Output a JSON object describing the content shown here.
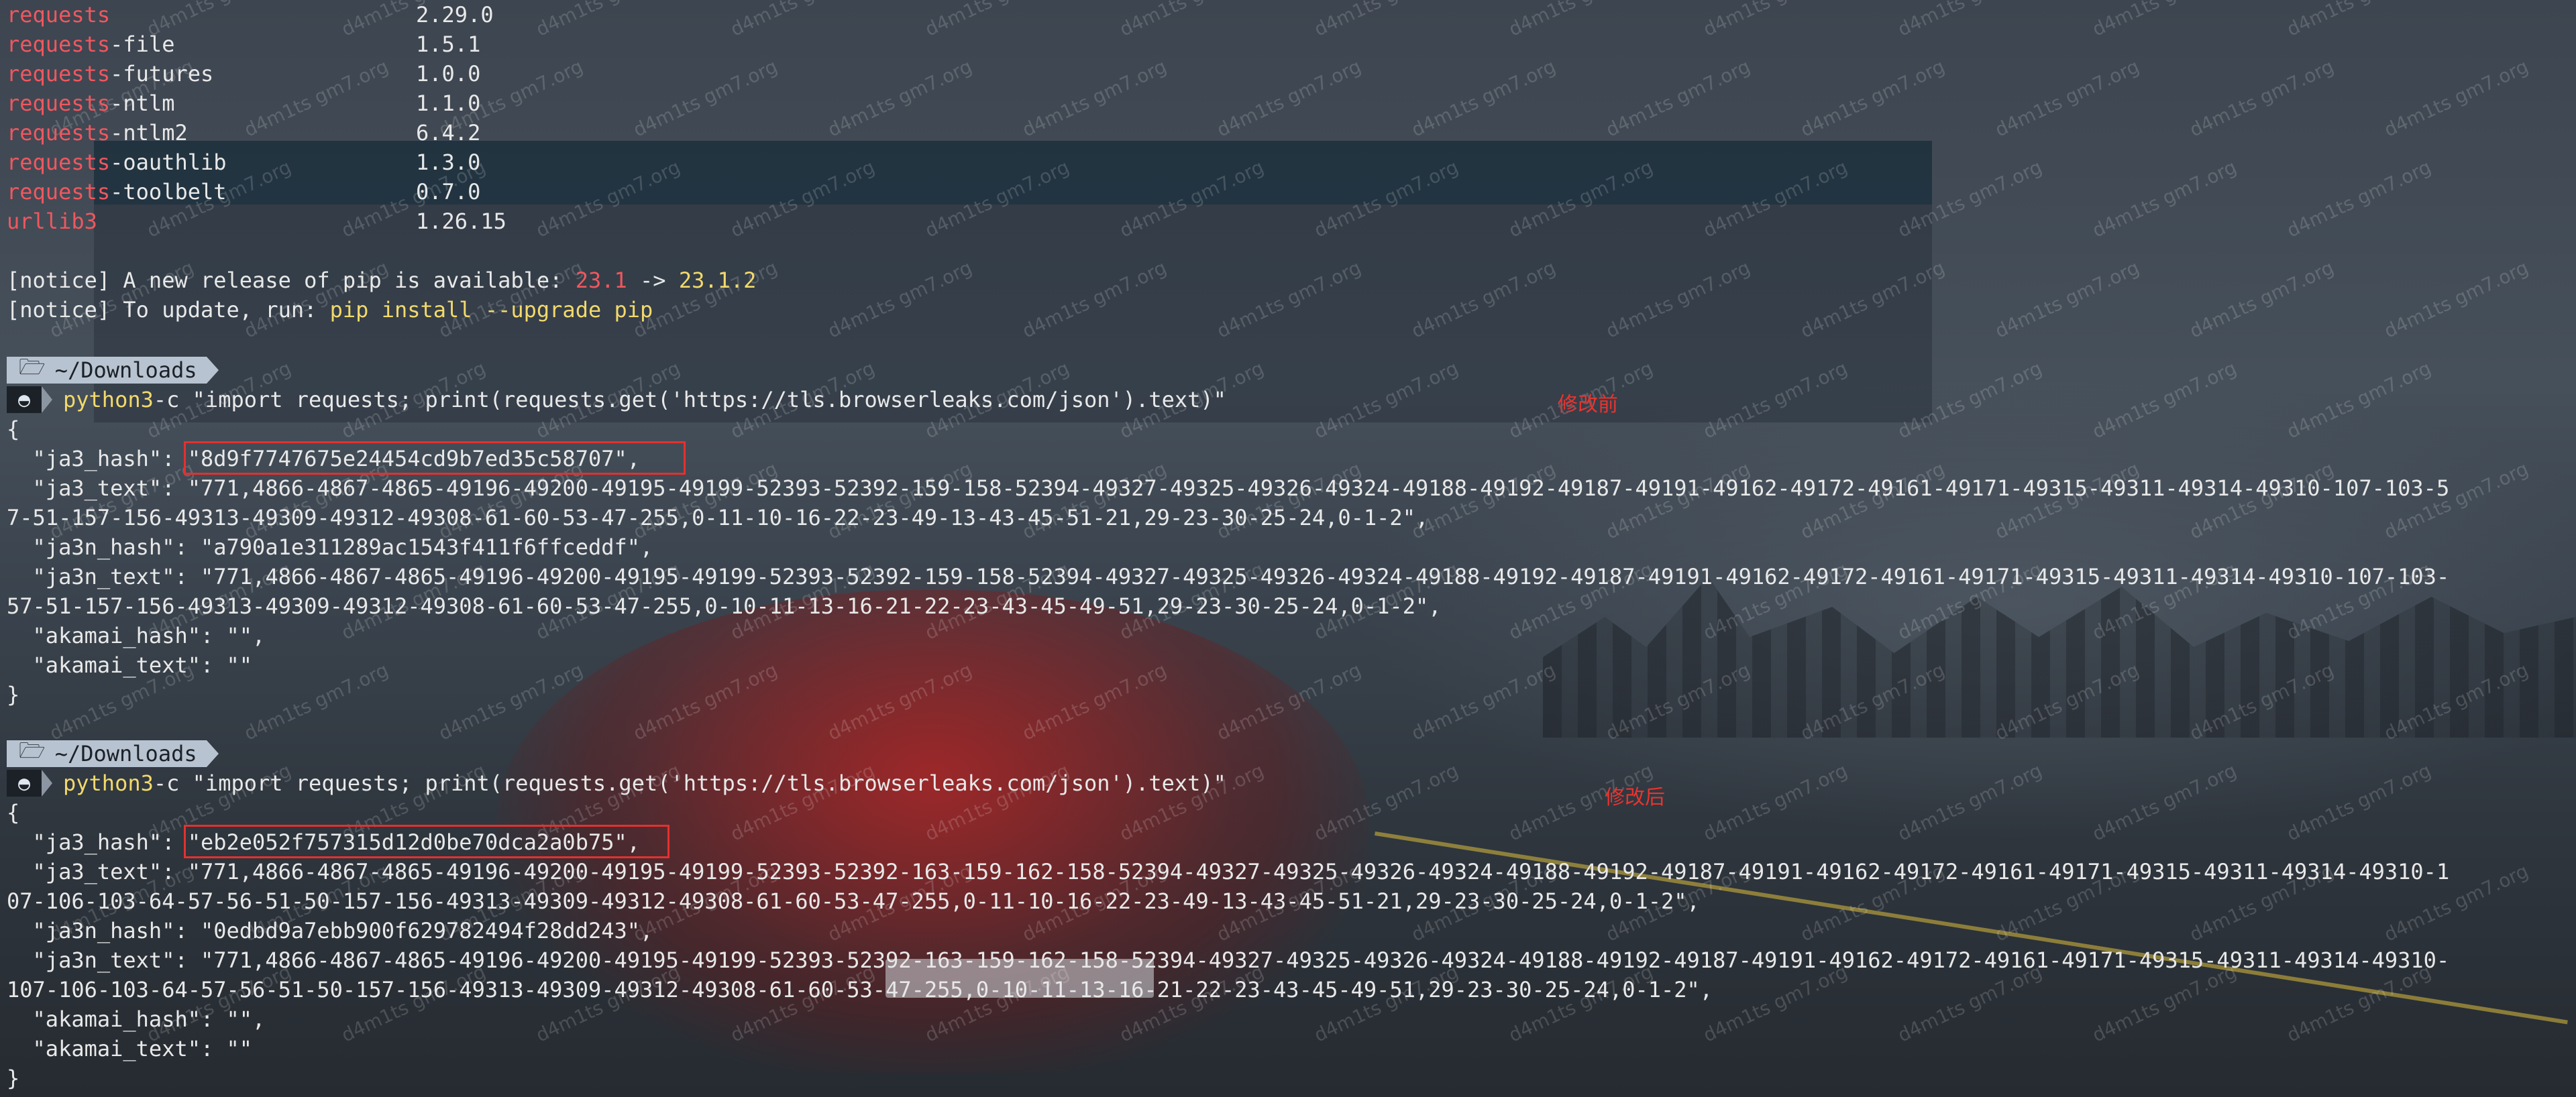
{
  "packages": [
    {
      "prefix": "requests",
      "rest": "",
      "version": "2.29.0"
    },
    {
      "prefix": "requests",
      "rest": "-file",
      "version": "1.5.1"
    },
    {
      "prefix": "requests",
      "rest": "-futures",
      "version": "1.0.0"
    },
    {
      "prefix": "requests",
      "rest": "-ntlm",
      "version": "1.1.0"
    },
    {
      "prefix": "requests",
      "rest": "-ntlm2",
      "version": "6.4.2"
    },
    {
      "prefix": "requests",
      "rest": "-oauthlib",
      "version": "1.3.0"
    },
    {
      "prefix": "requests",
      "rest": "-toolbelt",
      "version": "0.7.0"
    },
    {
      "prefix": "urllib3",
      "rest": "",
      "version": "1.26.15"
    }
  ],
  "notice1": {
    "tag": "[notice]",
    "text": " A new release of pip is available: ",
    "old": "23.1",
    "arrow": " -> ",
    "new": "23.1.2"
  },
  "notice2": {
    "tag": "[notice]",
    "text": " To update, run: ",
    "cmd": "pip install --upgrade pip"
  },
  "prompt": {
    "folder_icon": "🗁",
    "path": "~/Downloads",
    "os_icon": "◓"
  },
  "command": {
    "exe": "python3",
    "args": " -c \"import requests; print(requests.get('https://tls.browserleaks.com/json').text)\""
  },
  "before": {
    "label": "修改前",
    "open": "{",
    "ja3_hash_key": "  \"ja3_hash\": ",
    "ja3_hash_val": "\"8d9f7747675e24454cd9b7ed35c58707\",",
    "ja3_text_1": "  \"ja3_text\": \"771,4866-4867-4865-49196-49200-49195-49199-52393-52392-159-158-52394-49327-49325-49326-49324-49188-49192-49187-49191-49162-49172-49161-49171-49315-49311-49314-49310-107-103-5",
    "ja3_text_2": "7-51-157-156-49313-49309-49312-49308-61-60-53-47-255,0-11-10-16-22-23-49-13-43-45-51-21,29-23-30-25-24,0-1-2\",",
    "ja3n_hash": "  \"ja3n_hash\": \"a790a1e311289ac1543f411f6ffceddf\",",
    "ja3n_text_1": "  \"ja3n_text\": \"771,4866-4867-4865-49196-49200-49195-49199-52393-52392-159-158-52394-49327-49325-49326-49324-49188-49192-49187-49191-49162-49172-49161-49171-49315-49311-49314-49310-107-103-",
    "ja3n_text_2": "57-51-157-156-49313-49309-49312-49308-61-60-53-47-255,0-10-11-13-16-21-22-23-43-45-49-51,29-23-30-25-24,0-1-2\",",
    "akamai_hash": "  \"akamai_hash\": \"\",",
    "akamai_text": "  \"akamai_text\": \"\"",
    "close": "}"
  },
  "after": {
    "label": "修改后",
    "open": "{",
    "ja3_hash_key": "  \"ja3_hash\": ",
    "ja3_hash_val": "\"eb2e052f757315d12d0be70dca2a0b75\",",
    "ja3_text_1": "  \"ja3_text\": \"771,4866-4867-4865-49196-49200-49195-49199-52393-52392-163-159-162-158-52394-49327-49325-49326-49324-49188-49192-49187-49191-49162-49172-49161-49171-49315-49311-49314-49310-1",
    "ja3_text_2": "07-106-103-64-57-56-51-50-157-156-49313-49309-49312-49308-61-60-53-47-255,0-11-10-16-22-23-49-13-43-45-51-21,29-23-30-25-24,0-1-2\",",
    "ja3n_hash": "  \"ja3n_hash\": \"0edbd9a7ebb900f629782494f28dd243\",",
    "ja3n_text_1": "  \"ja3n_text\": \"771,4866-4867-4865-49196-49200-49195-49199-52393-52392-163-159-162-158-52394-49327-49325-49326-49324-49188-49192-49187-49191-49162-49172-49161-49171-49315-49311-49314-49310-",
    "ja3n_text_2": "107-106-103-64-57-56-51-50-157-156-49313-49309-49312-49308-61-60-53-47-255,0-10-11-13-16-21-22-23-43-45-49-51,29-23-30-25-24,0-1-2\",",
    "akamai_hash": "  \"akamai_hash\": \"\",",
    "akamai_text": "  \"akamai_text\": \"\"",
    "close": "}"
  },
  "watermark": "d4m1ts gm7.org",
  "colors": {
    "accent_red": "#f0575f",
    "accent_yellow": "#f2d96b",
    "annotation_red": "#e8342f"
  }
}
